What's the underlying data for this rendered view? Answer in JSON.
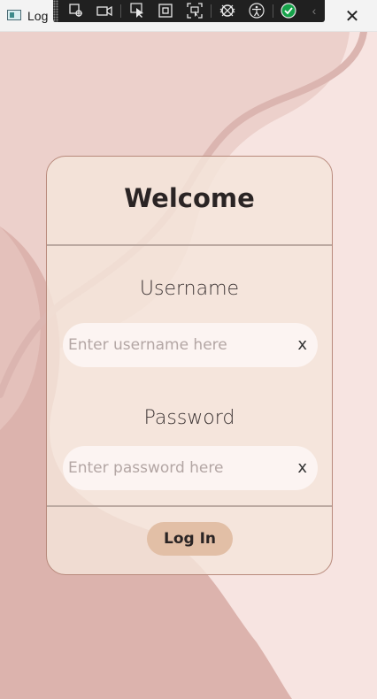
{
  "window": {
    "title": "Log",
    "close_glyph": "✕"
  },
  "debug_toolbar": {
    "tools": [
      "live-visual-tree-icon",
      "video-icon",
      "select-element-icon",
      "display-layout-adorners-icon",
      "track-focus-icon",
      "binding-failures-icon",
      "accessibility-icon",
      "ui-checker-icon",
      "collapse-icon"
    ]
  },
  "card": {
    "title": "Welcome",
    "username": {
      "label": "Username",
      "placeholder": "Enter username here",
      "value": "",
      "clear_label": "x"
    },
    "password": {
      "label": "Password",
      "placeholder": "Enter password here",
      "value": "",
      "clear_label": "x"
    },
    "login_label": "Log In"
  },
  "colors": {
    "background": "#f6e4e1",
    "card_border": "#b88a7c",
    "button": "#e2bfa6"
  }
}
